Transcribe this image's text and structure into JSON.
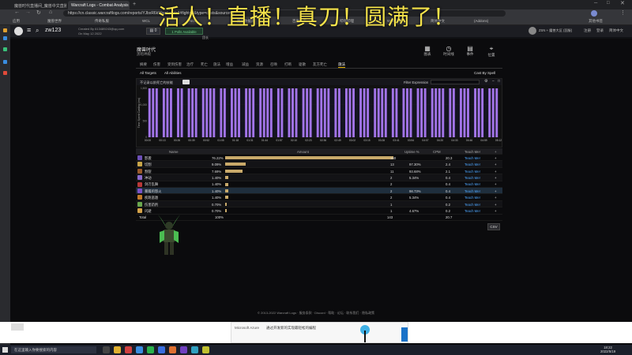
{
  "overlay": {
    "title": "活人！直播！真刀！圆满了！"
  },
  "browser": {
    "tabs": [
      "魔兽时代直播间_魔兽中文直播平台",
      "Warcraft Logs - Combat Analysis for Warcraft"
    ],
    "url": "https://cn.classic.warcraftlogs.com/reports/YJbxR6kWwaLd4Xr3#fight=4&type=casts&source=7",
    "bookmarks": [
      "应用",
      "魔兽世界",
      "传奇私服",
      "WCL",
      "NGA",
      "魔兽数据库",
      "百度一下",
      "哔哩哔哩",
      "WLK攻略",
      "简体中文",
      "(Addons)",
      "其他书签"
    ]
  },
  "wcl": {
    "user": "zw123",
    "created_by": "Created By 613489243@qq.com",
    "created_date": "On May 12 2022",
    "subscribe_btn": "1 Polls Available",
    "guild_tag": "团长",
    "header_right": [
      "ZSN + 魔兽大区 (国服)",
      "注册",
      "登录",
      "简体中文"
    ],
    "report_name": "魔兽时代",
    "report_sub": "黑暗神殿",
    "nav": [
      {
        "icon": "▦",
        "label": "图表"
      },
      {
        "icon": "◷",
        "label": "时间线"
      },
      {
        "icon": "▤",
        "label": "事件"
      },
      {
        "icon": "⌖",
        "label": "位置"
      }
    ],
    "tabs": [
      "摘要",
      "伤害",
      "受到伤害",
      "治疗",
      "死亡",
      "施法",
      "增益",
      "减益",
      "资源",
      "召唤",
      "打断",
      "驱散",
      "友方死亡",
      "施法"
    ],
    "selected_tab": "施法",
    "filters": {
      "targets": "All Targets",
      "abilities": "All Abilities",
      "view": "Cast By Spell"
    },
    "chart_toolbar": {
      "left": "不记录以前死亡的技能",
      "right": "Filter Expression"
    }
  },
  "chart_data": {
    "type": "bar",
    "ylabel": "Time Spent Casting (ms)",
    "y_ticks": [
      "1,500",
      "1,000",
      "500",
      "0"
    ],
    "x_ticks": [
      "00:00",
      "00:13",
      "00:26",
      "00:39",
      "00:52",
      "01:05",
      "01:18",
      "01:31",
      "01:44",
      "01:57",
      "02:10",
      "02:23",
      "02:36",
      "02:49",
      "03:02",
      "03:15",
      "03:28",
      "03:41",
      "03:54",
      "04:07",
      "04:20",
      "04:33",
      "04:46",
      "04:59",
      "05:12"
    ],
    "values": [
      1500,
      1500,
      1500,
      0,
      1500,
      1500,
      1500,
      0,
      1500,
      1500,
      0,
      1500,
      1500,
      1500,
      0,
      1500,
      1500,
      1500,
      1500,
      0,
      1500,
      1500,
      0,
      1500,
      1500,
      1500,
      0,
      1500,
      1500,
      1500,
      0,
      1500,
      1500,
      1500,
      1500,
      0,
      1500,
      1500,
      0,
      1500,
      1500,
      1500,
      0,
      1500,
      1500,
      1500,
      0,
      1500,
      1500,
      1500,
      1500,
      0,
      1500,
      1500,
      0,
      1500,
      1500,
      1500,
      0,
      1500,
      1500,
      1500,
      0,
      1500,
      1500,
      1500,
      1500,
      0,
      1500,
      1500,
      0,
      1500,
      1500,
      1500,
      0,
      1500,
      1500,
      1500,
      0,
      1500,
      1500,
      1500,
      1500,
      0,
      1500,
      1500,
      0,
      1500,
      1500,
      1500,
      0,
      1500,
      1500,
      1500,
      0,
      1500,
      1500,
      1500
    ],
    "ylim": [
      0,
      1500
    ],
    "bar_color": "#a274e8"
  },
  "table": {
    "headers": [
      "Name",
      "Amount",
      "Uptime %",
      "CPM",
      "Teach Me!"
    ],
    "rows": [
      {
        "name": "影袭",
        "pct": "76.22%",
        "frac": 0.7622,
        "casts": "160",
        "uptime": "",
        "cpm": "20.3",
        "color": "#6c4fb6"
      },
      {
        "name": "切割",
        "pct": "9.09%",
        "frac": 0.0909,
        "casts": "13",
        "uptime": "97.30%",
        "cpm": "2.4",
        "color": "#c9a648"
      },
      {
        "name": "割裂",
        "pct": "7.69%",
        "frac": 0.0769,
        "casts": "11",
        "uptime": "93.68%",
        "cpm": "2.1",
        "color": "#9a5a2a"
      },
      {
        "name": "冲动",
        "pct": "1.40%",
        "frac": 0.014,
        "casts": "2",
        "uptime": "5.34%",
        "cpm": "0.4",
        "color": "#8a6acd"
      },
      {
        "name": "剑刃乱舞",
        "pct": "1.40%",
        "frac": 0.014,
        "casts": "2",
        "uptime": "",
        "cpm": "0.4",
        "color": "#b83838"
      },
      {
        "name": "暴躁的怒火",
        "pct": "1.40%",
        "frac": 0.014,
        "casts": "2",
        "uptime": "98.73%",
        "cpm": "0.4",
        "color": "#7a52c8"
      },
      {
        "name": "疾跑逃遁",
        "pct": "1.40%",
        "frac": 0.014,
        "casts": "2",
        "uptime": "5.34%",
        "cpm": "0.4",
        "color": "#c27a2a"
      },
      {
        "name": "伤害药剂",
        "pct": "0.70%",
        "frac": 0.007,
        "casts": "1",
        "uptime": "",
        "cpm": "0.2",
        "color": "#6aa84f"
      },
      {
        "name": "闪避",
        "pct": "0.70%",
        "frac": 0.007,
        "casts": "1",
        "uptime": "4.67%",
        "cpm": "0.2",
        "color": "#d4a24a"
      }
    ],
    "teach": "Teach Me!",
    "plus": "+",
    "total": {
      "label": "Total",
      "pct": "100%",
      "casts": "143",
      "cpm": "20.7"
    },
    "csv": "CSV"
  },
  "footer": "© 2013-2022 Warcraft Logs · 服务条款 · Discord · 帮助 · 论坛 · 联系我们 · 隐私政策",
  "ad": {
    "brand": "Microsoft Azure",
    "text": "通过开发新的实现最轻松的编程"
  },
  "taskbar": {
    "search": "在这里输入你要搜索的内容",
    "time": "18:22",
    "date": "2022/5/19"
  }
}
